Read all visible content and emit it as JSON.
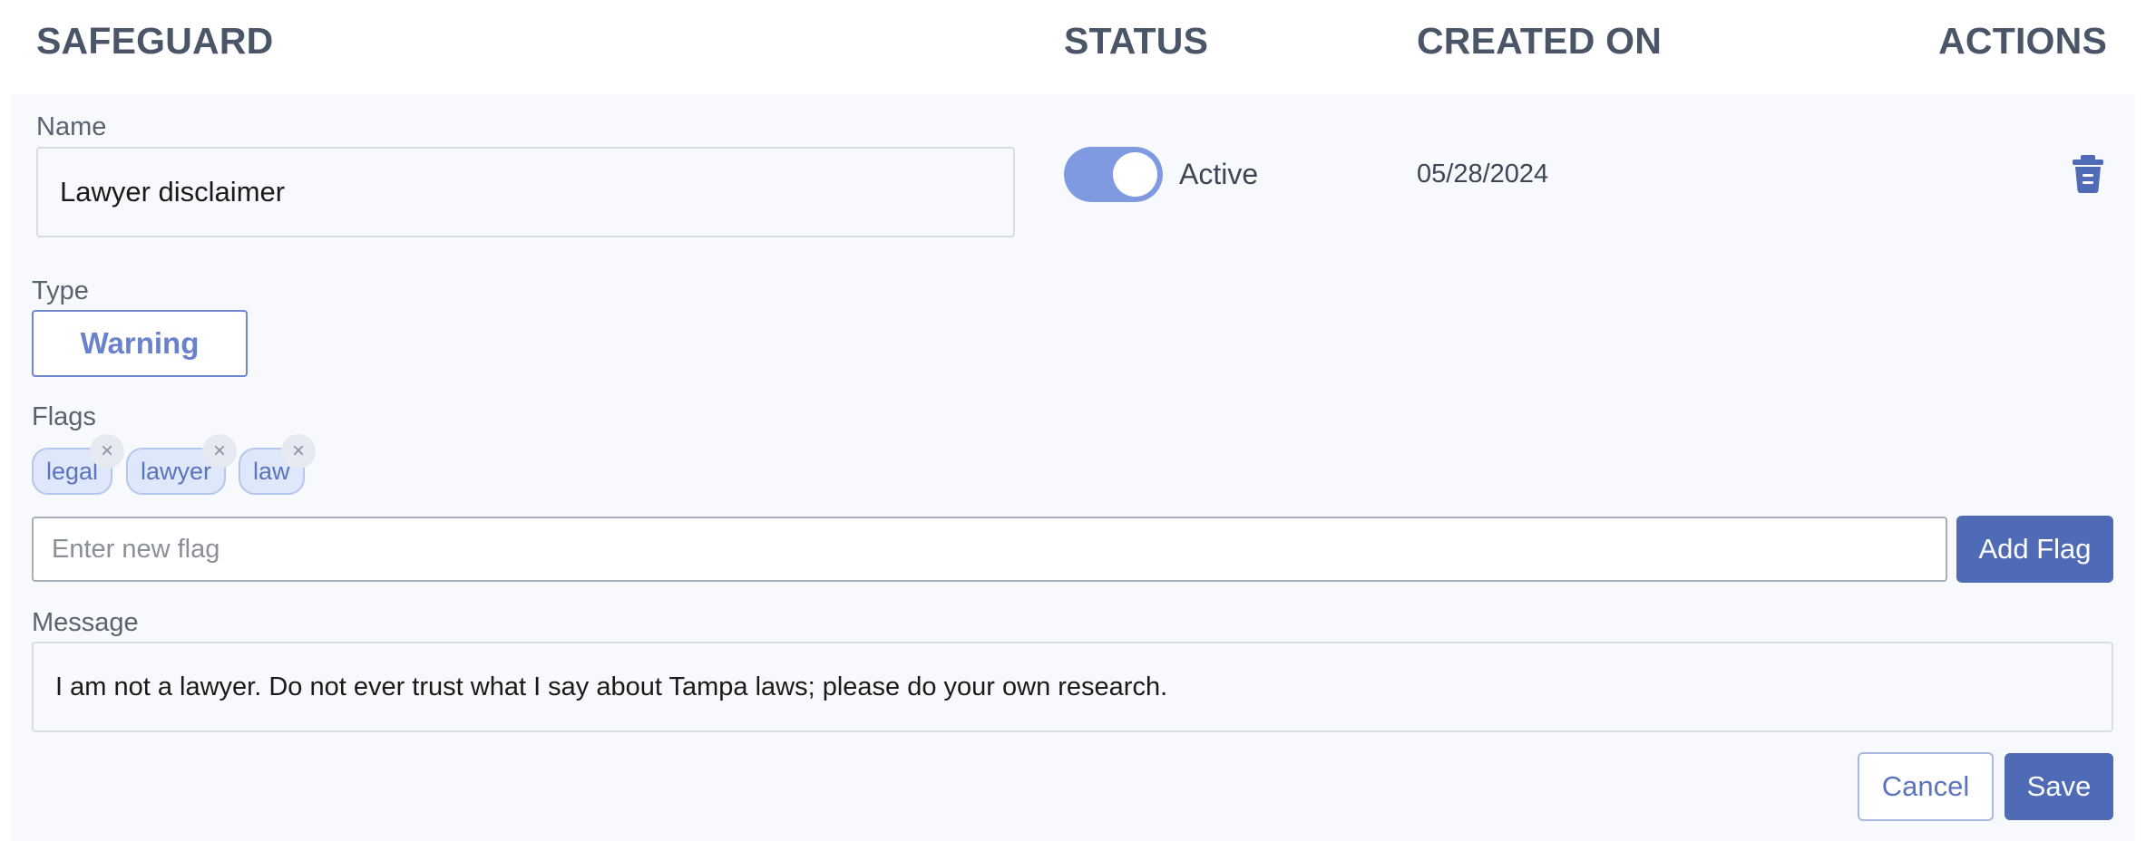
{
  "table_header": {
    "safeguard": "SAFEGUARD",
    "status": "STATUS",
    "created_on": "CREATED ON",
    "actions": "ACTIONS"
  },
  "safeguard": {
    "name_label": "Name",
    "name_value": "Lawyer disclaimer",
    "status_active": true,
    "status_label": "Active",
    "created_on": "05/28/2024",
    "type_label": "Type",
    "type_value": "Warning",
    "flags_label": "Flags",
    "flags": [
      "legal",
      "lawyer",
      "law"
    ],
    "flag_remove_glyph": "×",
    "new_flag_placeholder": "Enter new flag",
    "add_flag_label": "Add Flag",
    "message_label": "Message",
    "message_value": "I am not a lawyer. Do not ever trust what I say about Tampa laws; please do your own research.",
    "cancel_label": "Cancel",
    "save_label": "Save"
  },
  "icons": {
    "delete": "trash-icon",
    "remove_flag": "close-icon"
  },
  "colors": {
    "accent": "#4f6bb5",
    "toggle_on": "#7f9ae0",
    "chip_bg": "#dfe7fa",
    "card_bg": "#f8f9fc"
  }
}
